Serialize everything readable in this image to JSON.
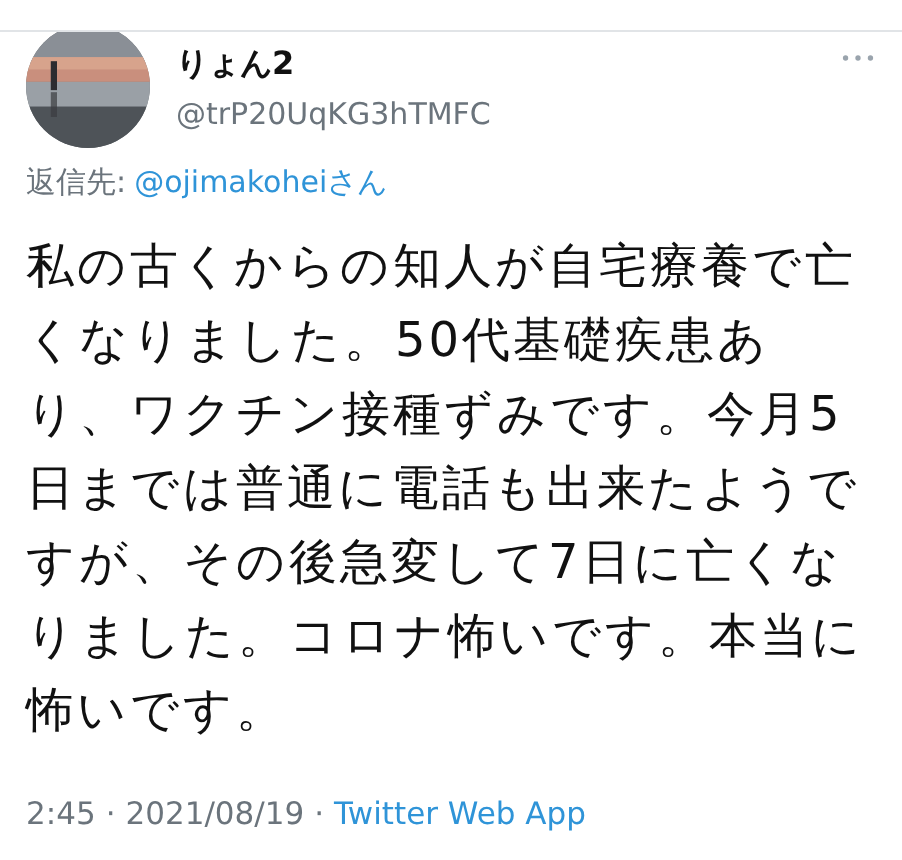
{
  "author": {
    "name": "りょん2",
    "handle": "@trP20UqKG3hTMFC"
  },
  "reply_to": {
    "label": "返信先:",
    "mention": "@ojimakoheiさん"
  },
  "body": "私の古くからの知人が自宅療養で亡くなりました。50代基礎疾患あり、ワクチン接種ずみです。今月5日までは普通に電話も出来たようですが、その後急変して7日に亡くなりました。コロナ怖いです。本当に怖いです。",
  "meta": {
    "time": "2:45",
    "sep1": "·",
    "date": "2021/08/19",
    "sep2": "·",
    "source": "Twitter Web App"
  }
}
